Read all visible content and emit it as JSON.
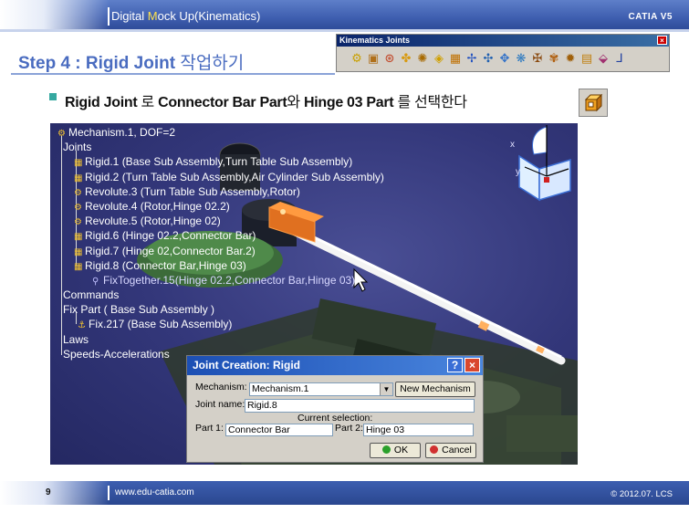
{
  "header": {
    "title_prefix": "Digital ",
    "title_m": "M",
    "title_rest": "ock Up(Kinematics)",
    "brand": "CATIA V5"
  },
  "step": {
    "title": "Step 4 : Rigid Joint ",
    "title_kr": "작업하기"
  },
  "toolbar": {
    "title": "Kinematics Joints",
    "close": "×",
    "icons": [
      "revolute-joint-icon",
      "prismatic-joint-icon",
      "cylindrical-joint-icon",
      "screw-joint-icon",
      "spherical-joint-icon",
      "planar-joint-icon",
      "rigid-joint-icon",
      "point-curve-joint-icon",
      "slide-curve-joint-icon",
      "roll-curve-joint-icon",
      "point-surface-joint-icon",
      "universal-joint-icon",
      "cv-joint-icon",
      "gear-joint-icon",
      "rack-joint-icon",
      "cable-joint-icon",
      "axis-system-joint-icon"
    ]
  },
  "instruction": {
    "part1": "Rigid Joint ",
    "part2": "로 ",
    "part3": "Connector Bar Part",
    "part4": "와 ",
    "part5": "Hinge 03 Part",
    "part6": " 를 선택한다"
  },
  "tree": {
    "root": "Mechanism.1, DOF=2",
    "joints": "Joints",
    "items": [
      {
        "icon": "rigid-icon",
        "label": "Rigid.1 (Base Sub Assembly,Turn Table Sub Assembly)"
      },
      {
        "icon": "rigid-icon",
        "label": "Rigid.2 (Turn Table Sub Assembly,Air Cylinder Sub Assembly)"
      },
      {
        "icon": "revolute-icon",
        "label": "Revolute.3 (Turn Table Sub Assembly,Rotor)"
      },
      {
        "icon": "revolute-icon",
        "label": "Revolute.4 (Rotor,Hinge 02.2)"
      },
      {
        "icon": "revolute-icon",
        "label": "Revolute.5 (Rotor,Hinge 02)"
      },
      {
        "icon": "rigid-icon",
        "label": "Rigid.6 (Hinge 02.2,Connector Bar)"
      },
      {
        "icon": "rigid-icon",
        "label": "Rigid.7 (Hinge 02,Connector Bar.2)"
      },
      {
        "icon": "rigid-icon",
        "label": "Rigid.8 (Connector Bar,Hinge 03)"
      }
    ],
    "fix_together": "FixTogether.15(Hinge 02.2,Connector Bar,Hinge 03)",
    "commands": "Commands",
    "fix_part": "Fix Part ( Base Sub Assembly )",
    "fix": "Fix.217 (Base Sub Assembly)",
    "laws": "Laws",
    "speeds": "Speeds-Accelerations"
  },
  "compass": {
    "x_label": "x",
    "y_label": "y"
  },
  "dialog": {
    "title": "Joint Creation: Rigid",
    "help": "?",
    "close": "×",
    "mechanism_label": "Mechanism:",
    "mechanism_value": "Mechanism.1",
    "new_mechanism": "New Mechanism",
    "joint_name_label": "Joint name:",
    "joint_name_value": "Rigid.8",
    "current_selection": "Current selection:",
    "part1_label": "Part 1:",
    "part1_value": "Connector Bar",
    "part2_label": "Part 2:",
    "part2_value": "Hinge 03",
    "ok": "OK",
    "cancel": "Cancel"
  },
  "footer": {
    "page": "9",
    "url": "www.edu-catia.com",
    "copyright": "© 2012.07. LCS"
  },
  "colors": {
    "accent": "#4a6cc0",
    "ok_dot": "#2aa02a",
    "cancel_dot": "#d03030"
  }
}
